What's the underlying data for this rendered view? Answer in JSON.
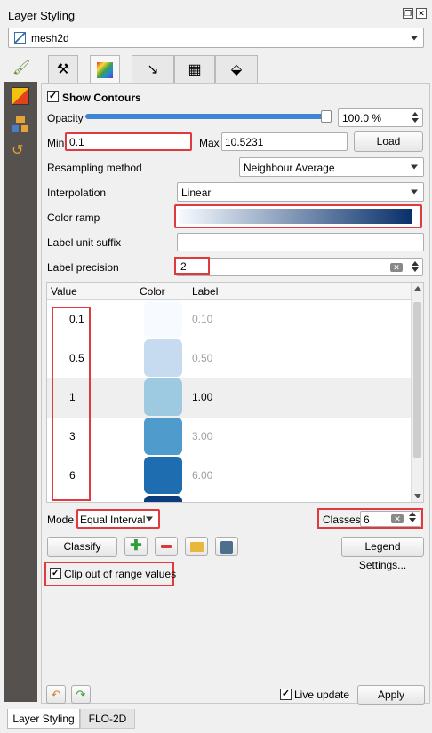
{
  "window": {
    "title": "Layer Styling",
    "float_icon": "float-icon",
    "close_icon": "close-icon"
  },
  "layer_combo": {
    "value": "mesh2d",
    "icon": "mesh-layer-icon"
  },
  "sidebar_icons": [
    "paintbrush-icon",
    "3d-cube-icon",
    "layers-icon",
    "history-icon"
  ],
  "tabs": [
    {
      "name": "tab-source",
      "icon": "hammer-wrench-icon"
    },
    {
      "name": "tab-contours",
      "icon": "contours-gradient-icon",
      "active": true
    },
    {
      "name": "tab-vectors",
      "icon": "arrow-icon"
    },
    {
      "name": "tab-mesh",
      "icon": "grid-icon"
    },
    {
      "name": "tab-3d",
      "icon": "3d-layer-icon"
    }
  ],
  "contours": {
    "show_label": "Show Contours",
    "show_checked": true,
    "opacity_label": "Opacity",
    "opacity_value": "100.0 %",
    "opacity_fraction": 1.0,
    "min_label": "Min",
    "min_value": "0.1",
    "max_label": "Max",
    "max_value": "10.5231",
    "load_label": "Load",
    "resampling_label": "Resampling method",
    "resampling_value": "Neighbour Average",
    "interpolation_label": "Interpolation",
    "interpolation_value": "Linear",
    "color_ramp_label": "Color ramp",
    "color_ramp_start": "#f7fbff",
    "color_ramp_end": "#08306b",
    "unit_suffix_label": "Label unit suffix",
    "unit_suffix_value": "",
    "precision_label": "Label precision",
    "precision_value": "2"
  },
  "table": {
    "headers": {
      "value": "Value",
      "color": "Color",
      "label": "Label"
    },
    "rows": [
      {
        "value": "0.1",
        "color": "#f7fbff",
        "label": "0.10",
        "dim": true
      },
      {
        "value": "0.5",
        "color": "#c6dbef",
        "label": "0.50",
        "dim": true
      },
      {
        "value": "1",
        "color": "#9ecae1",
        "label": "1.00",
        "dim": false
      },
      {
        "value": "3",
        "color": "#4f9bcb",
        "label": "3.00",
        "dim": true
      },
      {
        "value": "6",
        "color": "#1f6db1",
        "label": "6.00",
        "dim": true
      },
      {
        "value": "",
        "color": "#0b3d7e",
        "label": "",
        "dim": true
      }
    ]
  },
  "mode": {
    "label": "Mode",
    "value": "Equal Interval",
    "classes_label": "Classes",
    "classes_value": "6"
  },
  "actions": {
    "classify_label": "Classify",
    "legend_settings_label": "Legend Settings...",
    "clip_label": "Clip out of range values",
    "clip_checked": true
  },
  "footer": {
    "live_update_label": "Live update",
    "live_update_checked": true,
    "apply_label": "Apply"
  },
  "bottom_tabs": [
    "Layer Styling",
    "FLO-2D"
  ]
}
